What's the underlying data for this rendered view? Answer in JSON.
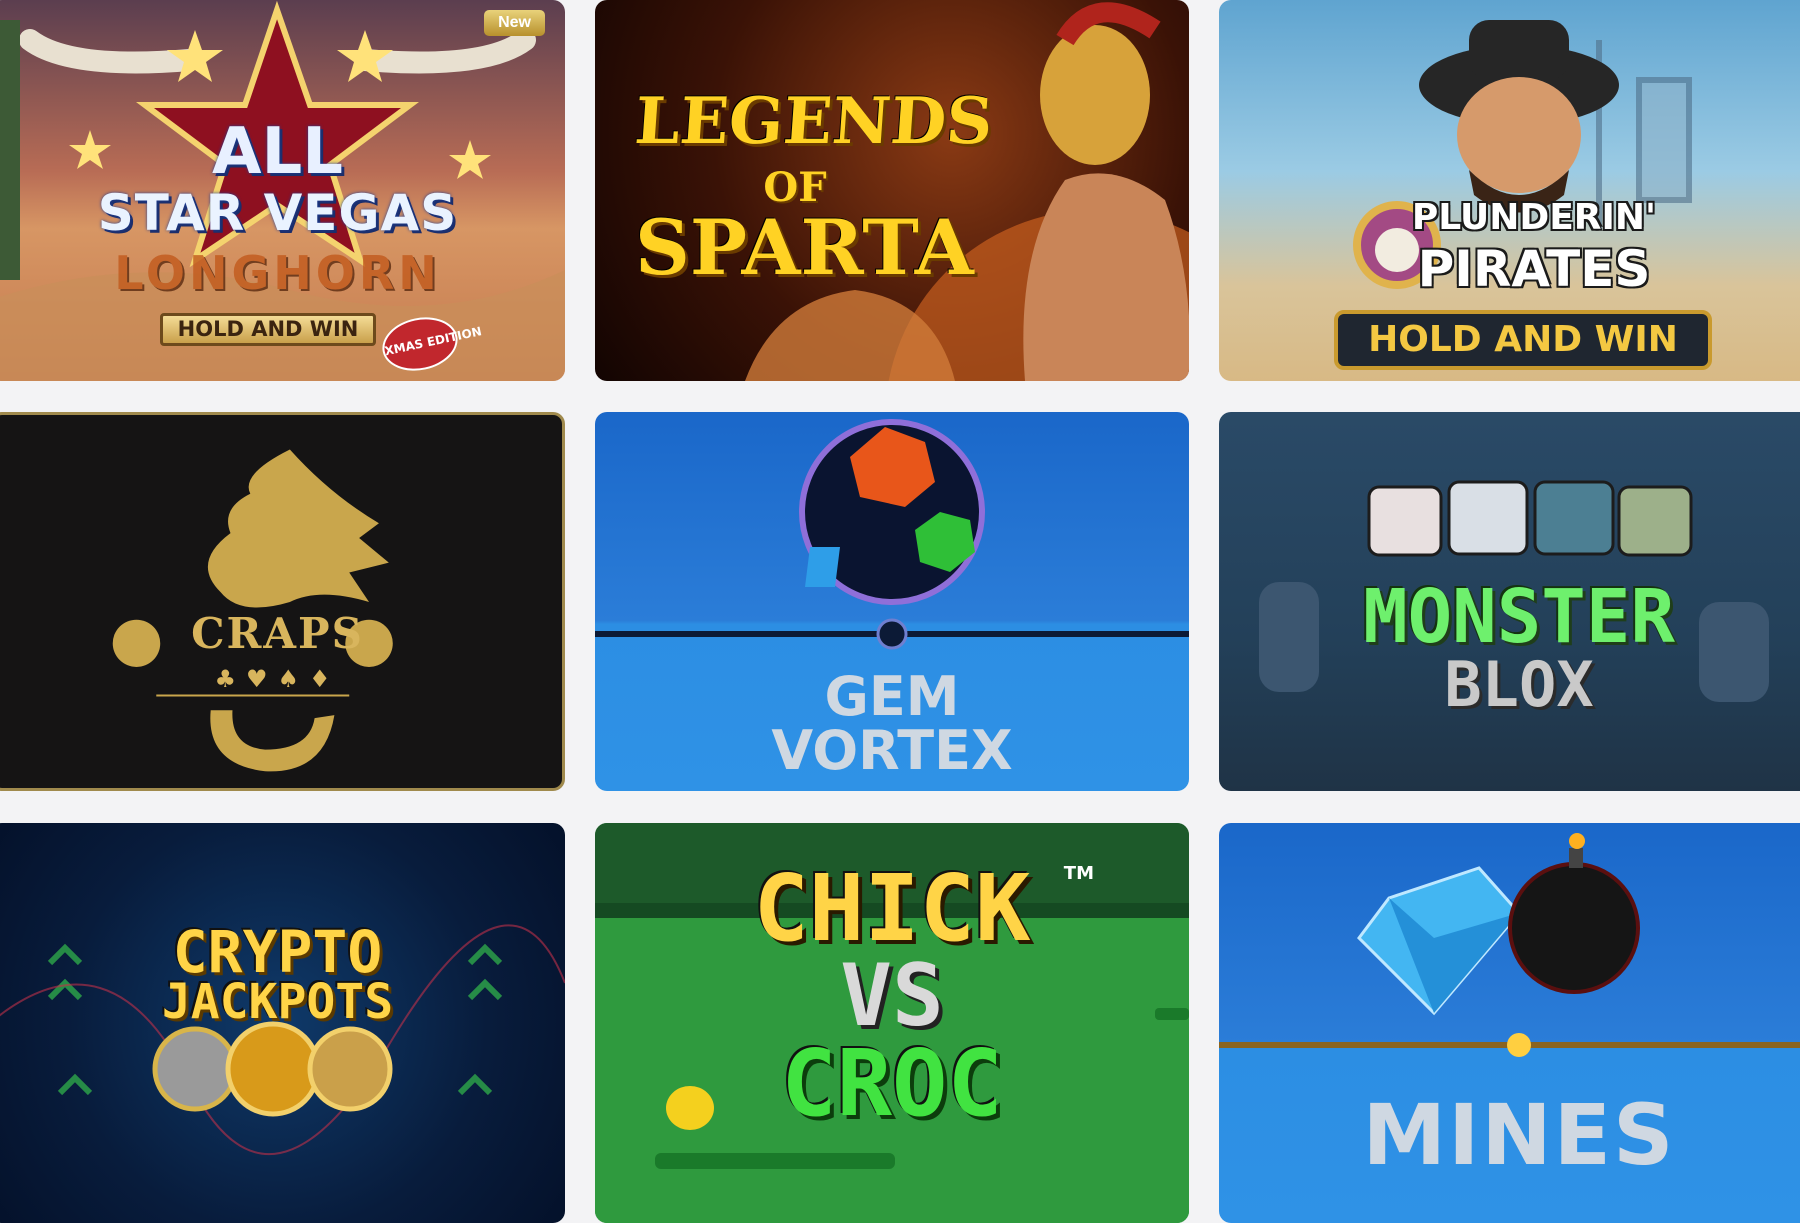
{
  "games": [
    {
      "name": "All Star Vegas Longhorn Hold and Win Xmas Edition",
      "badge": "New",
      "title_lines": [
        "ALL",
        "STAR VEGAS",
        "LONGHORN",
        "HOLD AND WIN",
        "XMAS EDITION"
      ]
    },
    {
      "name": "Legends of Sparta",
      "title_lines": [
        "LEGENDS",
        "OF",
        "SPARTA"
      ]
    },
    {
      "name": "Plunderin' Pirates Hold and Win",
      "title_lines": [
        "PLUNDERIN'",
        "PIRATES",
        "HOLD AND WIN"
      ],
      "trademark": "™"
    },
    {
      "name": "Craps",
      "title_lines": [
        "CRAPS",
        "♣♥♠♦"
      ]
    },
    {
      "name": "Gem Vortex",
      "title_lines": [
        "GEM",
        "VORTEX"
      ]
    },
    {
      "name": "Monster Blox",
      "title_lines": [
        "MONSTER",
        "BLOX"
      ]
    },
    {
      "name": "Crypto Jackpots",
      "title_lines": [
        "CRYPTO",
        "JACKPOTS"
      ]
    },
    {
      "name": "Chick vs Croc",
      "title_lines": [
        "CHICK",
        "VS",
        "CROC"
      ],
      "trademark": "TM"
    },
    {
      "name": "Mines",
      "title_lines": [
        "MINES"
      ]
    }
  ]
}
